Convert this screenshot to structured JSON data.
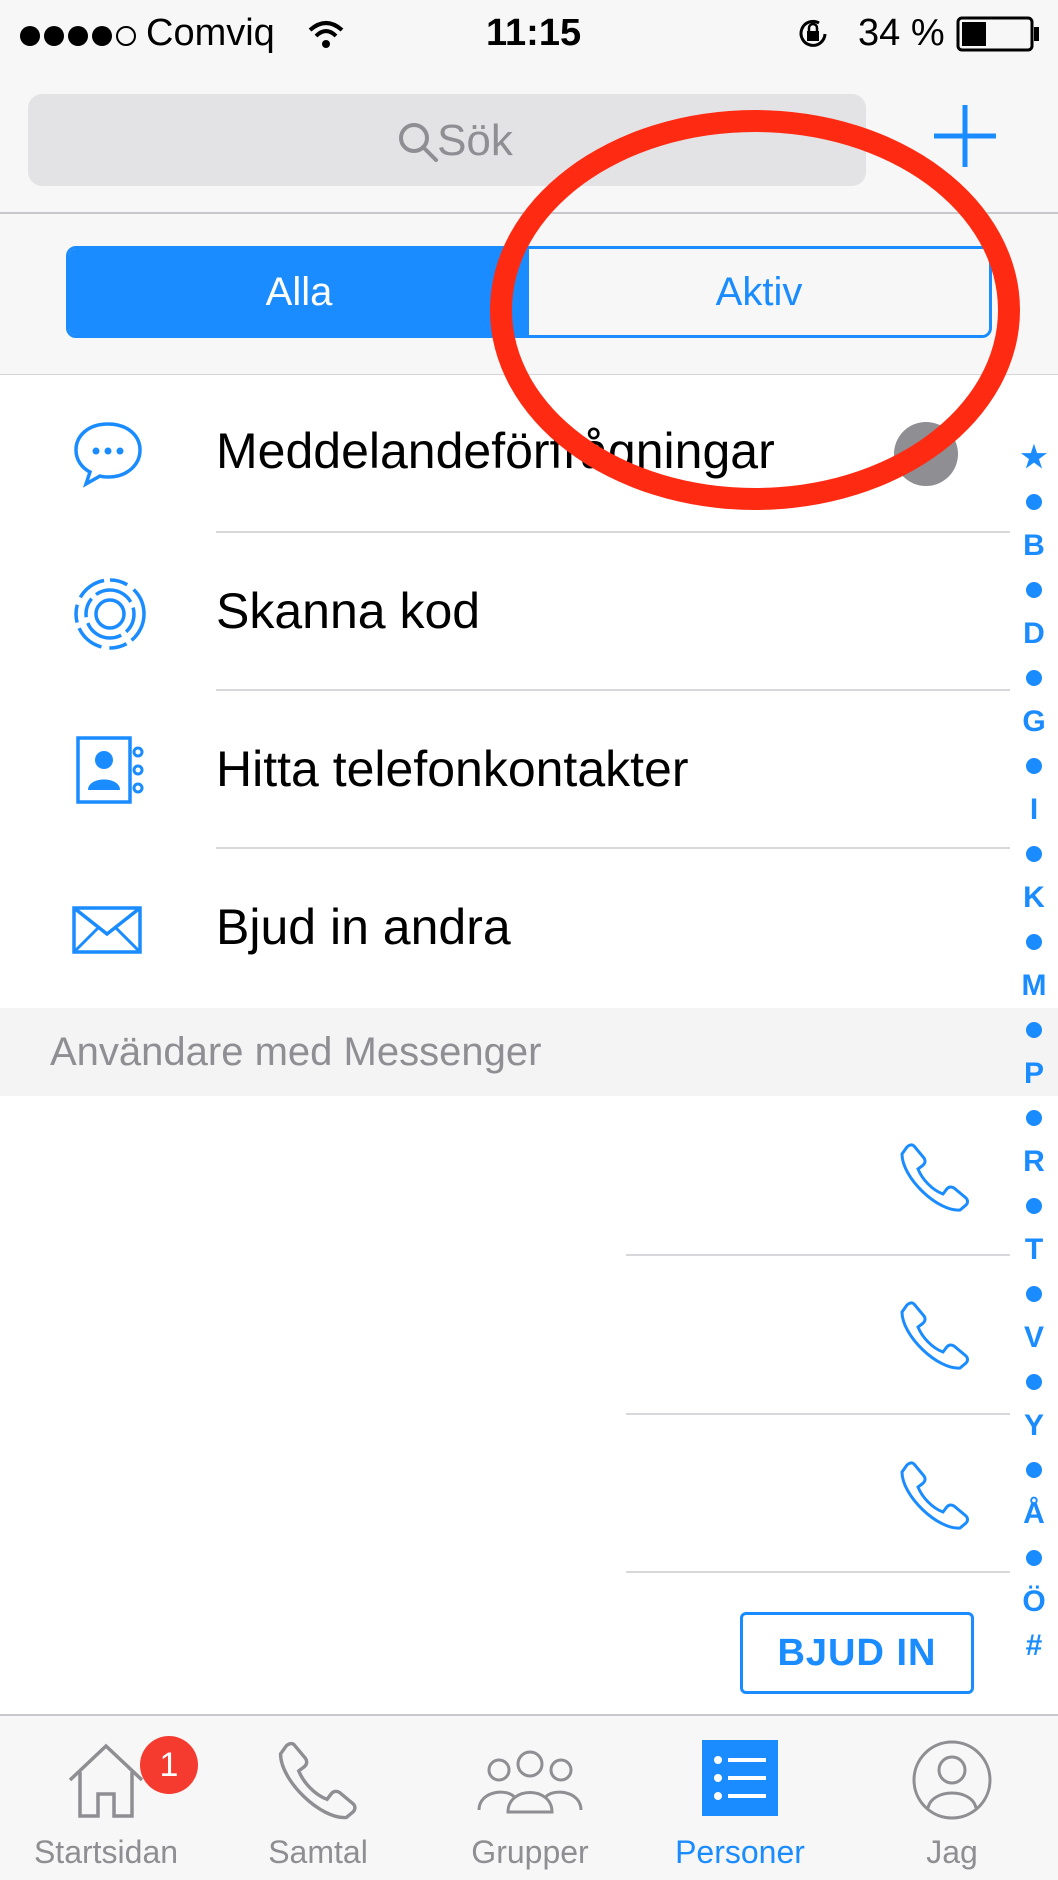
{
  "status_bar": {
    "carrier": "Comviq",
    "time": "11:15",
    "battery": "34 %"
  },
  "header": {
    "search_placeholder": "Sök"
  },
  "segments": {
    "all": "Alla",
    "active": "Aktiv"
  },
  "menu_items": [
    {
      "label": "Meddelandeförfrågningar",
      "icon": "chat-bubble-icon"
    },
    {
      "label": "Skanna kod",
      "icon": "scan-code-icon"
    },
    {
      "label": "Hitta telefonkontakter",
      "icon": "contacts-book-icon"
    },
    {
      "label": "Bjud in andra",
      "icon": "envelope-icon"
    }
  ],
  "section_header": "Användare med Messenger",
  "invite_label": "BJUD IN",
  "index": [
    "★",
    "B",
    "D",
    "G",
    "I",
    "K",
    "M",
    "P",
    "R",
    "T",
    "V",
    "Y",
    "Å",
    "Ö",
    "#"
  ],
  "tabs": [
    {
      "label": "Startsidan",
      "icon": "home-icon",
      "badge": "1"
    },
    {
      "label": "Samtal",
      "icon": "phone-icon"
    },
    {
      "label": "Grupper",
      "icon": "groups-icon"
    },
    {
      "label": "Personer",
      "icon": "people-list-icon"
    },
    {
      "label": "Jag",
      "icon": "profile-icon"
    }
  ],
  "colors": {
    "accent": "#1a8cff",
    "annotation": "#ff2a12",
    "badge": "#f53b30"
  }
}
